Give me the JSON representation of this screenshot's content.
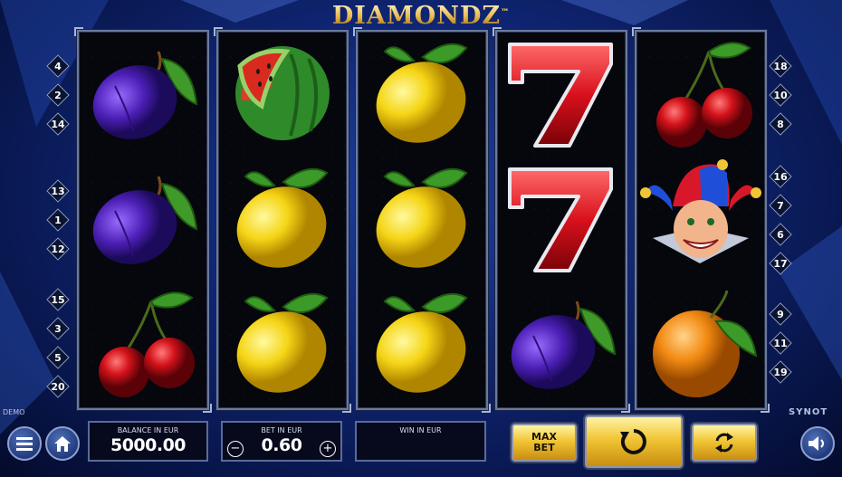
{
  "game": {
    "title": "DIAMONDZ",
    "trademark": "™",
    "mode": "DEMO",
    "provider": "SYNOT"
  },
  "reels": [
    [
      "plum-icon",
      "plum-icon",
      "cherry-icon"
    ],
    [
      "watermelon-icon",
      "lemon-icon",
      "lemon-icon"
    ],
    [
      "lemon-icon",
      "lemon-icon",
      "lemon-icon"
    ],
    [
      "seven-icon",
      "seven-icon",
      "plum-icon"
    ],
    [
      "cherry-icon",
      "joker-icon",
      "orange-icon"
    ]
  ],
  "paylines": {
    "left": [
      [
        "4",
        "2",
        "14"
      ],
      [
        "13",
        "1",
        "12"
      ],
      [
        "15",
        "3",
        "5",
        "20"
      ]
    ],
    "right": [
      [
        "18",
        "10",
        "8"
      ],
      [
        "16",
        "7",
        "6",
        "17"
      ],
      [
        "9",
        "11",
        "19"
      ]
    ]
  },
  "balance": {
    "label": "BALANCE IN EUR",
    "value": "5000.00"
  },
  "bet": {
    "label": "BET IN EUR",
    "value": "0.60",
    "minus": "−",
    "plus": "+"
  },
  "win": {
    "label": "WIN IN EUR",
    "value": ""
  },
  "buttons": {
    "max_bet_line1": "MAX",
    "max_bet_line2": "BET",
    "spin": "spin-icon",
    "autoplay": "autoplay-icon",
    "menu": "menu-icon",
    "home": "home-icon",
    "sound": "sound-icon"
  },
  "colors": {
    "accent_gold": "#f1c535",
    "background": "#0f2470",
    "reel_border": "#6a7a9c"
  }
}
